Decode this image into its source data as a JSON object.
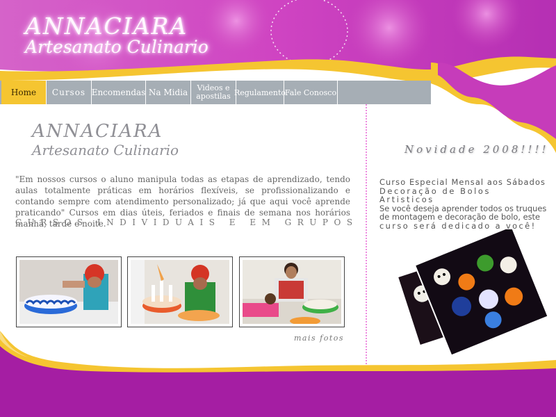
{
  "header": {
    "brand_line1": "ANNACIARA",
    "brand_line2": "Artesanato Culinario"
  },
  "nav": {
    "items": [
      {
        "label": "Home"
      },
      {
        "label": "Cursos"
      },
      {
        "label": "Encomendas"
      },
      {
        "label": "Na Midia"
      },
      {
        "label": "Videos e apostilas"
      },
      {
        "label": "Regulamento"
      },
      {
        "label": "Fale Conosco"
      }
    ]
  },
  "main": {
    "logo_line1": "ANNACIARA",
    "logo_line2": "Artesanato Culinario",
    "intro": "\"Em nossos cursos o aluno manipula todas as etapas de aprendizado, tendo aulas totalmente práticas em horários flexíveis, se profissionalizando e contando sempre com atendimento personalizado; já que aqui você aprende praticando\" Cursos em dias úteis, feriados e finais de semana nos horários manhã, tarde e noite.",
    "courses_line": "CURSOS INDIVIDUAIS E EM GRUPOS",
    "more_photos": "mais fotos"
  },
  "sidebar": {
    "novidade_title": "Novidade 2008!!!!",
    "promo_lines": [
      "Curso Especial Mensal aos Sábados",
      "Decoração de Bolos Artisticos",
      "Se você deseja aprender todos os truques",
      "de montagem e decoração de bolo, este",
      "curso será dedicado a você!"
    ]
  },
  "colors": {
    "header_purple": "#cc3cb8",
    "accent_yellow": "#f5c531",
    "nav_gray": "#a6aeb5",
    "footer_purple": "#a51ea3"
  }
}
